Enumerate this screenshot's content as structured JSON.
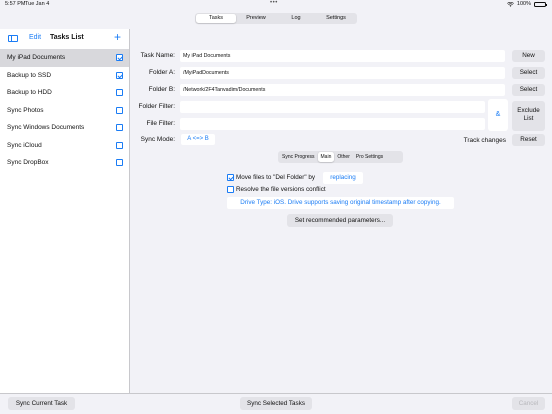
{
  "status_bar": {
    "time": "5:57 PM",
    "date": "Tue Jan 4",
    "battery": "100%"
  },
  "top_tabs": [
    {
      "label": "Tasks",
      "active": true
    },
    {
      "label": "Preview",
      "active": false
    },
    {
      "label": "Log",
      "active": false
    },
    {
      "label": "Settings",
      "active": false
    }
  ],
  "sidebar": {
    "edit_label": "Edit",
    "title": "Tasks List",
    "items": [
      {
        "label": "My iPad Documents",
        "checked": true,
        "selected": true
      },
      {
        "label": "Backup to SSD",
        "checked": true,
        "selected": false
      },
      {
        "label": "Backup to HDD",
        "checked": false,
        "selected": false
      },
      {
        "label": "Sync Photos",
        "checked": false,
        "selected": false
      },
      {
        "label": "Sync Windows Documents",
        "checked": false,
        "selected": false
      },
      {
        "label": "Sync iCloud",
        "checked": false,
        "selected": false
      },
      {
        "label": "Sync DropBox",
        "checked": false,
        "selected": false
      }
    ]
  },
  "form": {
    "task_name_label": "Task Name:",
    "task_name_value": "My iPad Documents",
    "new_button": "New",
    "folder_a_label": "Folder A:",
    "folder_a_value": "/MyiPadDocuments",
    "folder_b_label": "Folder B:",
    "folder_b_value": "/Network/2F4Tanvadim/Documents",
    "select_button": "Select",
    "folder_filter_label": "Folder Filter:",
    "folder_filter_value": "",
    "file_filter_label": "File Filter:",
    "file_filter_value": "",
    "amp_button": "&",
    "exclude_list_button_line1": "Exclude",
    "exclude_list_button_line2": "List",
    "sync_mode_label": "Sync Mode:",
    "sync_mode_value": "A <=> B",
    "track_changes_label": "Track changes",
    "reset_button": "Reset"
  },
  "sub_tabs": [
    {
      "label": "Sync Progress",
      "active": false
    },
    {
      "label": "Main",
      "active": true
    },
    {
      "label": "Other",
      "active": false
    },
    {
      "label": "Pro Settings",
      "active": false
    }
  ],
  "options": {
    "move_files_label": "Move files to \"Del Folder\" by",
    "move_files_checked": true,
    "replacing_button": "replacing",
    "resolve_conflict_label": "Resolve the file versions conflict",
    "resolve_conflict_checked": false,
    "drive_type_text": "Drive Type: iOS. Drive supports saving original timestamp after copying.",
    "recommended_button": "Set recommended parameters..."
  },
  "bottom": {
    "sync_current": "Sync Current Task",
    "sync_selected": "Sync Selected Tasks",
    "cancel": "Cancel"
  }
}
